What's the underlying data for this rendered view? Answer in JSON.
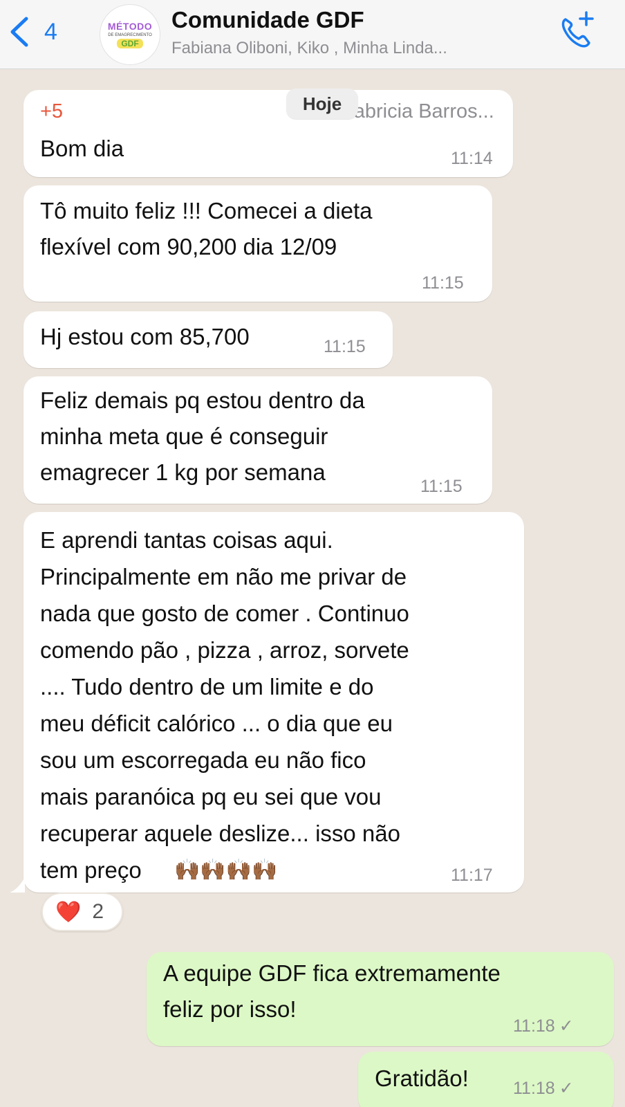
{
  "header": {
    "back_count": "4",
    "logo": {
      "line1": "MÉTODO",
      "line2": "DE EMAGRECIMENTO",
      "line3": "GDF"
    },
    "title": "Comunidade GDF",
    "subtitle": "Fabiana Oliboni, Kiko , Minha Linda..."
  },
  "date_chip": "Hoje",
  "messages": [
    {
      "sender_extra": "+5",
      "sender_name": "Fabricia Barros...",
      "text_lines": [
        "Bom dia"
      ],
      "time": "11:14"
    },
    {
      "text_lines": [
        "Tô muito feliz !!! Comecei a dieta",
        "flexível com 90,200 dia 12/09"
      ],
      "time": "11:15"
    },
    {
      "text_lines": [
        "Hj estou com 85,700"
      ],
      "time": "11:15"
    },
    {
      "text_lines": [
        "Feliz demais pq estou dentro da",
        "minha meta que é conseguir",
        "emagrecer 1 kg por  semana"
      ],
      "time": "11:15"
    },
    {
      "text_lines": [
        "E aprendi tantas coisas aqui.",
        "Principalmente em não me privar de",
        "nada que gosto de comer . Continuo",
        "comendo pão , pizza , arroz, sorvete",
        ".... Tudo dentro de um limite e do",
        "meu déficit calórico ... o dia que eu",
        "sou um escorregada eu não fico",
        "mais paranóica pq eu sei que vou",
        "recuperar aquele deslize... isso não",
        "tem preço"
      ],
      "emoji": "🙌🏾🙌🏾🙌🏾🙌🏾",
      "time": "11:17",
      "reaction": {
        "emoji": "❤️",
        "count": "2"
      }
    }
  ],
  "outgoing": [
    {
      "text_lines": [
        "A equipe GDF fica extremamente",
        "feliz por isso!"
      ],
      "time": "11:18",
      "status": "✓"
    },
    {
      "text_lines": [
        "Gratidão!"
      ],
      "time": "11:18",
      "status": "✓"
    }
  ],
  "colors": {
    "accent_blue": "#1a7cf2",
    "sender_red": "#e8563b",
    "outgoing_bubble": "#dcf8c6",
    "chat_background": "#ece5dd"
  },
  "icons": {
    "back": "chevron-left-icon",
    "call": "add-call-icon",
    "reaction": "heart-icon",
    "status": "check-icon"
  }
}
